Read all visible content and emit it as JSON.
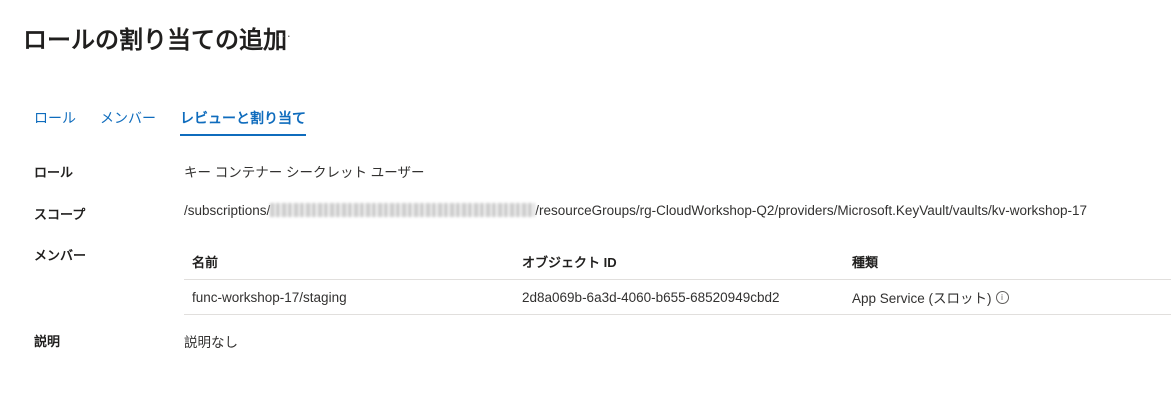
{
  "page": {
    "title": "ロールの割り当ての追加",
    "more_label": "···"
  },
  "tabs": [
    {
      "label": "ロール"
    },
    {
      "label": "メンバー"
    },
    {
      "label": "レビューと割り当て",
      "active": true
    }
  ],
  "review": {
    "role_label": "ロール",
    "role_value": "キー コンテナー シークレット ユーザー",
    "scope_label": "スコープ",
    "scope_prefix": "/subscriptions/",
    "scope_suffix": "/resourceGroups/rg-CloudWorkshop-Q2/providers/Microsoft.KeyVault/vaults/kv-workshop-17",
    "members_label": "メンバー",
    "description_label": "説明",
    "description_value": "説明なし"
  },
  "members_table": {
    "headers": [
      "名前",
      "オブジェクト ID",
      "種類"
    ],
    "rows": [
      {
        "name": "func-workshop-17/staging",
        "object_id": "2d8a069b-6a3d-4060-b655-68520949cbd2",
        "type": "App Service (スロット)"
      }
    ]
  },
  "icons": {
    "info": "info-icon",
    "more": "more-icon"
  },
  "colors": {
    "accent": "#0f6cbd",
    "text": "#323130",
    "border": "#e1dfdd"
  }
}
